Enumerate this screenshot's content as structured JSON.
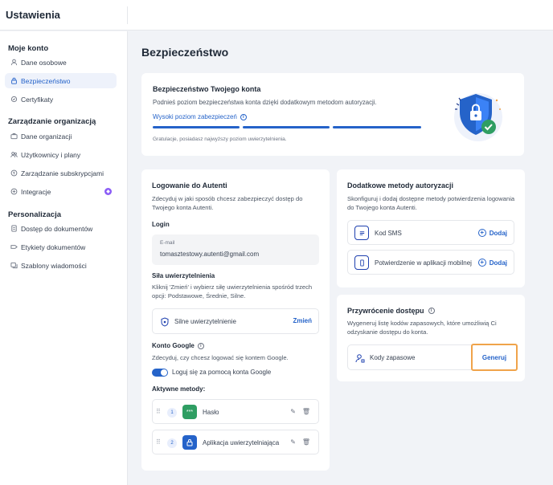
{
  "app": {
    "title": "Ustawienia"
  },
  "sidebar": {
    "sections": [
      {
        "title": "Moje konto"
      },
      {
        "title": "Zarządzanie organizacją"
      },
      {
        "title": "Personalizacja"
      }
    ],
    "items": [
      {
        "label": "Dane osobowe",
        "icon": "user-icon"
      },
      {
        "label": "Bezpieczeństwo",
        "icon": "lock-icon",
        "active": true
      },
      {
        "label": "Certyfikaty",
        "icon": "certificate-icon"
      },
      {
        "label": "Dane organizacji",
        "icon": "briefcase-icon"
      },
      {
        "label": "Użytkownicy i plany",
        "icon": "users-icon"
      },
      {
        "label": "Zarządzanie subskrypcjami",
        "icon": "subscription-icon"
      },
      {
        "label": "Integracje",
        "icon": "integrations-icon"
      },
      {
        "label": "Dostęp do dokumentów",
        "icon": "document-icon"
      },
      {
        "label": "Etykiety dokumentów",
        "icon": "tag-icon"
      },
      {
        "label": "Szablony wiadomości",
        "icon": "template-icon"
      }
    ]
  },
  "main": {
    "title": "Bezpieczeństwo",
    "security": {
      "title": "Bezpieczeństwo Twojego konta",
      "description": "Podnieś poziom bezpieczeństwa konta dzięki dodatkowym metodom autoryzacji.",
      "level_label": "Wysoki poziom zabezpieczeń",
      "level": 1.0,
      "note": "Gratulacje, posiadasz najwyższy poziom uwierzytelnienia."
    },
    "login": {
      "title": "Logowanie do Autenti",
      "description": "Zdecyduj w jaki sposób chcesz zabezpieczyć dostęp do Twojego konta Autenti.",
      "login_label": "Login",
      "email_label": "E-mail",
      "email_value": "tomasztestowy.autenti@gmail.com",
      "strength_title": "Siła uwierzytelnienia",
      "strength_desc": "Kliknij 'Zmień' i wybierz siłę uwierzytelnienia spośród trzech opcji: Podstawowe, Średnie, Silne.",
      "strength_value": "Silne uwierzytelnienie",
      "change_label": "Zmień",
      "google_title": "Konto Google",
      "google_desc": "Zdecyduj, czy chcesz logować się kontem Google.",
      "google_toggle_label": "Loguj się za pomocą konta Google",
      "google_enabled": true,
      "active_methods_label": "Aktywne metody:",
      "methods": [
        {
          "num": "1",
          "label": "Hasło",
          "icon": "password-icon",
          "color": "#2f9e63"
        },
        {
          "num": "2",
          "label": "Aplikacja uwierzytelniająca",
          "icon": "phone-lock-icon",
          "color": "#2563c9"
        }
      ]
    },
    "auth": {
      "title": "Dodatkowe metody autoryzacji",
      "description": "Skonfiguruj i dodaj dostępne metody potwierdzenia logowania do Twojego konta Autenti.",
      "rows": [
        {
          "label": "Kod SMS",
          "icon": "sms-icon",
          "action": "Dodaj"
        },
        {
          "label": "Potwierdzenie w aplikacji mobilnej",
          "icon": "mobile-icon",
          "action": "Dodaj"
        }
      ]
    },
    "recovery": {
      "title": "Przywrócenie dostępu",
      "description": "Wygeneruj listę kodów zapasowych, które umożliwią Ci odzyskanie dostępu do konta.",
      "row_label": "Kody zapasowe",
      "button": "Generuj"
    }
  },
  "colors": {
    "accent": "#2563c9",
    "highlight": "#f0a34a",
    "success": "#2f9e63"
  }
}
